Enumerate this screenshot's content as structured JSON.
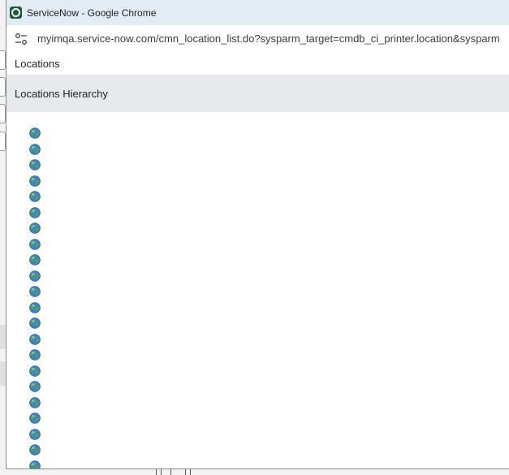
{
  "browser": {
    "window_title": "ServiceNow - Google Chrome",
    "url": "myimqa.service-now.com/cmn_location_list.do?sysparm_target=cmdb_ci_printer.location&sysparm"
  },
  "page": {
    "header_title": "Locations",
    "section_title": "Locations Hierarchy"
  },
  "tree": {
    "node_icon": "globe-icon",
    "node_count": 22
  },
  "colors": {
    "titlebar_bg": "#e2ecf5",
    "section_bg": "#e7e9ec",
    "globe_blue": "#3a86c8",
    "globe_green": "#5aa33f"
  }
}
